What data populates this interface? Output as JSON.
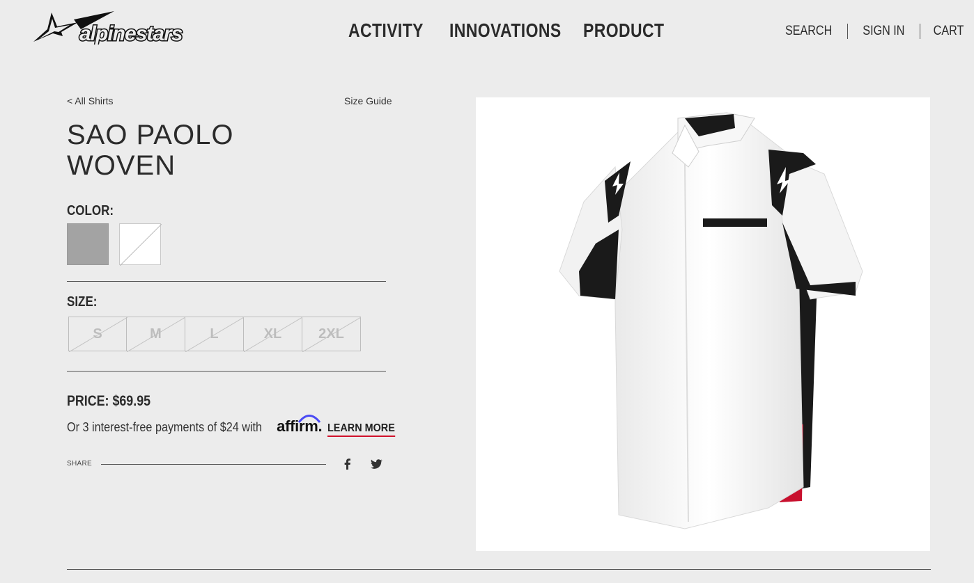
{
  "brand": {
    "name": "alpinestars"
  },
  "nav": {
    "main": [
      "ACTIVITY",
      "INNOVATIONS",
      "PRODUCT"
    ],
    "utility": [
      "SEARCH",
      "SIGN IN",
      "CART"
    ]
  },
  "breadcrumb": "< All Shirts",
  "size_guide": "Size Guide",
  "product": {
    "title_line1": "SAO PAOLO",
    "title_line2": "WOVEN",
    "color_label": "COLOR:",
    "colors": [
      {
        "name": "grey",
        "hex": "#a3a3a3",
        "available": true
      },
      {
        "name": "white",
        "hex": "#ffffff",
        "available": false
      }
    ],
    "size_label": "SIZE:",
    "sizes": [
      "S",
      "M",
      "L",
      "XL",
      "2XL"
    ],
    "price": "PRICE: $69.95",
    "financing": {
      "text": "Or 3 interest-free payments of $24 with",
      "provider": "affirm",
      "link": "LEARN MORE"
    },
    "share_label": "SHARE"
  },
  "icons": [
    "facebook-icon",
    "twitter-icon"
  ],
  "colors": {
    "background": "#ececec",
    "text": "#2b2b2b",
    "accent": "#d0112b",
    "affirm_arc": "#4a4af4"
  }
}
